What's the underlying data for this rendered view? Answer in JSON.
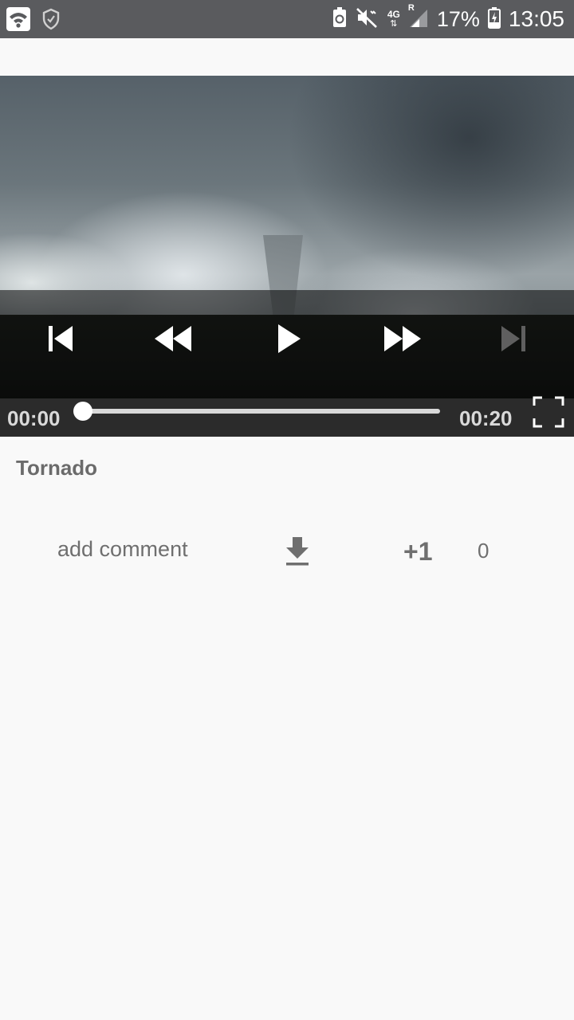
{
  "status_bar": {
    "battery_text": "17%",
    "time": "13:05",
    "network": "4G",
    "roaming": "R",
    "icons": [
      "wifi-icon",
      "shield-icon",
      "battery-saver-icon",
      "mute-vibrate-icon",
      "network-4g-icon",
      "signal-icon",
      "battery-charging-icon"
    ]
  },
  "player": {
    "controls": [
      "skip-previous-icon",
      "rewind-icon",
      "play-icon",
      "fast-forward-icon",
      "skip-next-icon"
    ],
    "current_time": "00:00",
    "duration": "00:20",
    "progress": 0.0
  },
  "video": {
    "title": "Tornado"
  },
  "actions": {
    "add_comment": "add comment",
    "plus_one": "+1",
    "plus_count": "0",
    "download_icon": "download-icon"
  },
  "colors": {
    "status_bar_bg": "#5a5b5e",
    "seekbar_bg": "#2b2b2b",
    "text_gray": "#6f6f6f",
    "page_bg": "#f9f9f9"
  }
}
